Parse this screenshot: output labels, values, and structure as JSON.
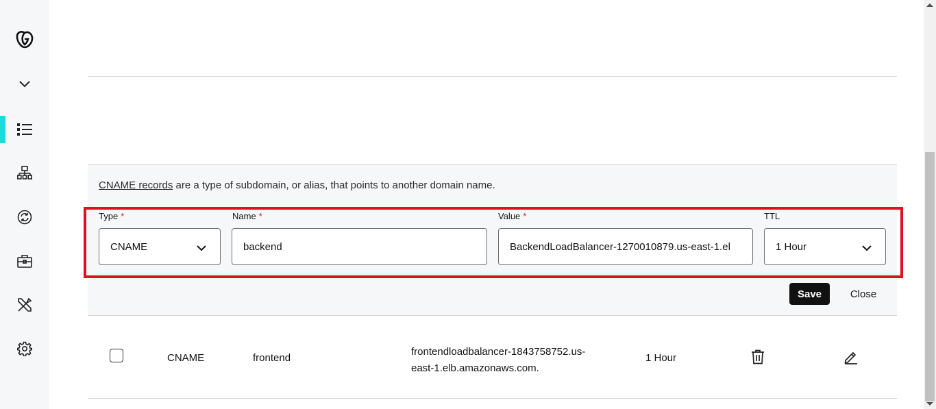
{
  "sidebar": {
    "items": [
      {
        "icon": "godaddy-logo-icon"
      },
      {
        "icon": "chevron-down-icon"
      },
      {
        "icon": "list-icon",
        "active": true
      },
      {
        "icon": "sitemap-icon"
      },
      {
        "icon": "sync-icon"
      },
      {
        "icon": "briefcase-icon"
      },
      {
        "icon": "tools-icon"
      },
      {
        "icon": "gear-icon"
      }
    ],
    "accent_color": "#1bdbdb"
  },
  "form": {
    "info_link": "CNAME records",
    "info_text": " are a type of subdomain, or alias, that points to another domain name.",
    "type_label": "Type",
    "name_label": "Name",
    "value_label": "Value",
    "ttl_label": "TTL",
    "required_mark": "*",
    "type_value": "CNAME",
    "name_value": "backend",
    "value_value": "BackendLoadBalancer-1270010879.us-east-1.el",
    "ttl_value": "1 Hour",
    "save_label": "Save",
    "close_label": "Close"
  },
  "record": {
    "type": "CNAME",
    "name": "frontend",
    "value_line1": "frontendloadbalancer-1843758752.us-",
    "value_line2": "east-1.elb.amazonaws.com.",
    "ttl": "1 Hour"
  },
  "colors": {
    "highlight": "#e0101e",
    "required": "#d21b2a"
  }
}
